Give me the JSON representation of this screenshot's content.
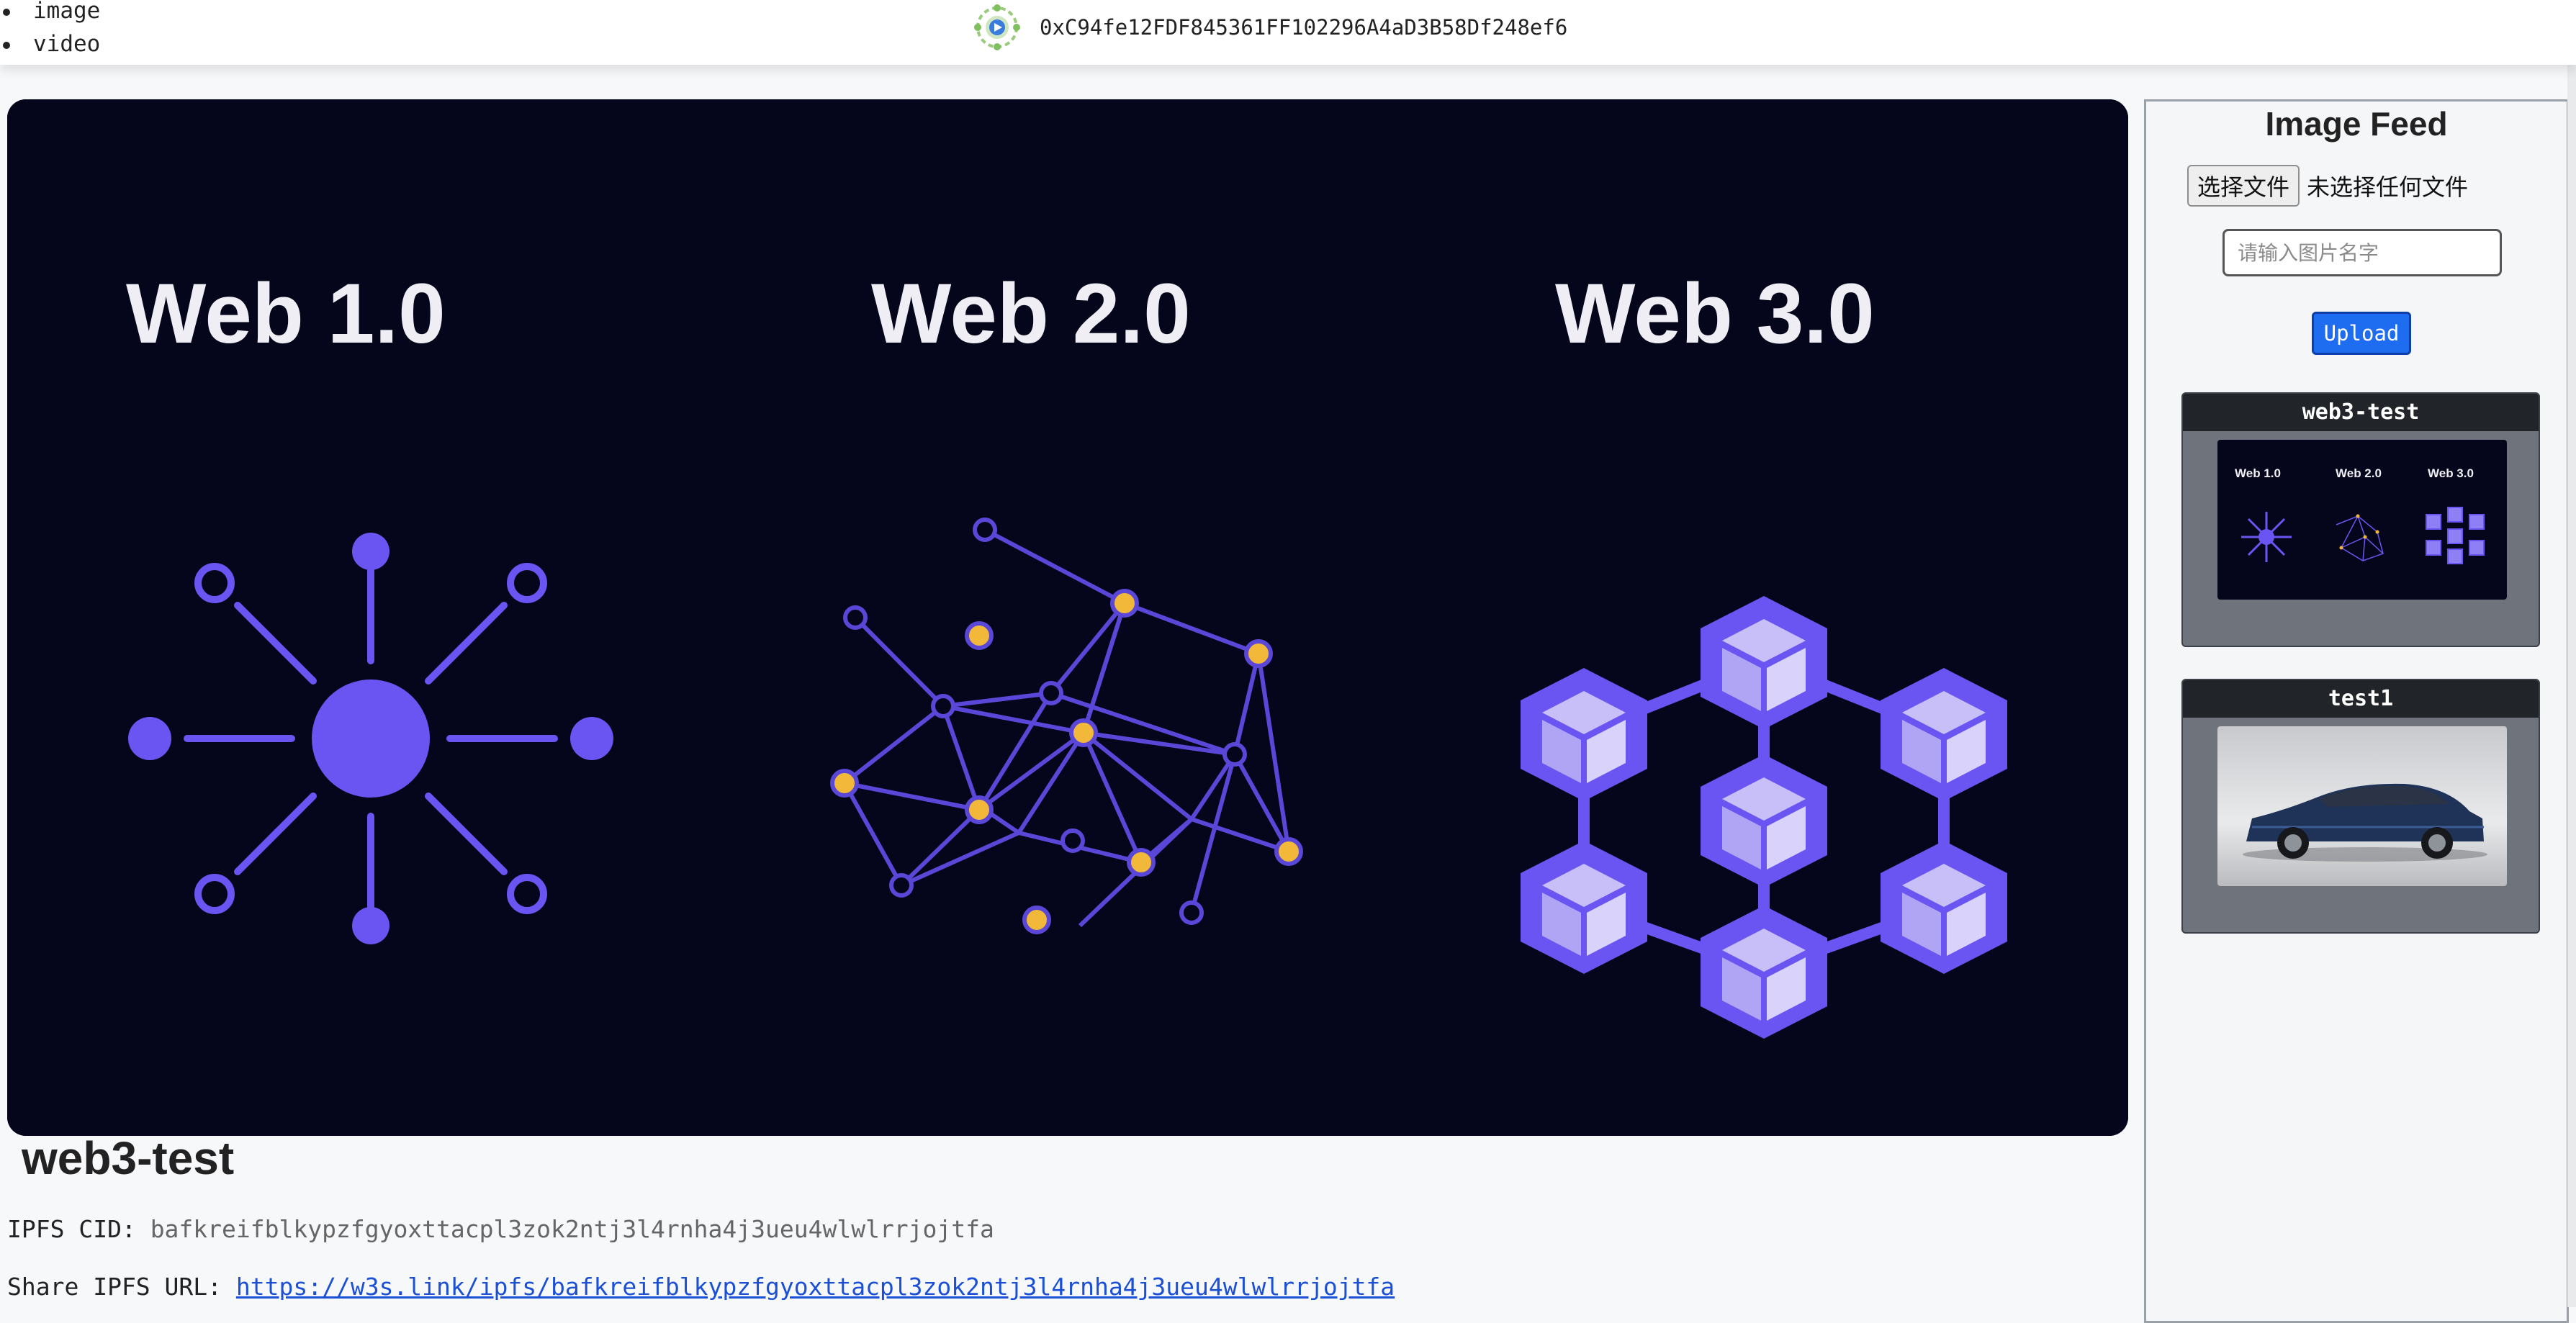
{
  "media_menu": {
    "items": [
      "image",
      "video"
    ]
  },
  "account": {
    "address": "0xC94fe12FDF845361FF102296A4aD3B58Df248ef6"
  },
  "viewer": {
    "image_labels": [
      "Web 1.0",
      "Web 2.0",
      "Web 3.0"
    ],
    "title": "web3-test",
    "cid_label": "IPFS CID:",
    "cid_value": "bafkreifblkypzfgyoxttacpl3zok2ntj3l4rnha4j3ueu4wlwlrrjojtfa",
    "url_label": "Share IPFS URL:",
    "url_value": "https://w3s.link/ipfs/bafkreifblkypzfgyoxttacpl3zok2ntj3l4rnha4j3ueu4wlwlrrjojtfa"
  },
  "sidebar": {
    "title": "Image Feed",
    "file_button": "选择文件",
    "file_status": "未选择任何文件",
    "name_placeholder": "请输入图片名字",
    "upload_label": "Upload",
    "cards": [
      {
        "title": "web3-test",
        "thumb_labels": [
          "Web 1.0",
          "Web 2.0",
          "Web 3.0"
        ]
      },
      {
        "title": "test1"
      }
    ]
  },
  "colors": {
    "hero_background": "#05051c",
    "accent_purple": "#6a55f2",
    "node_yellow": "#f2b83a",
    "upload_button": "#1e6cf0",
    "link": "#1a4fd6"
  }
}
